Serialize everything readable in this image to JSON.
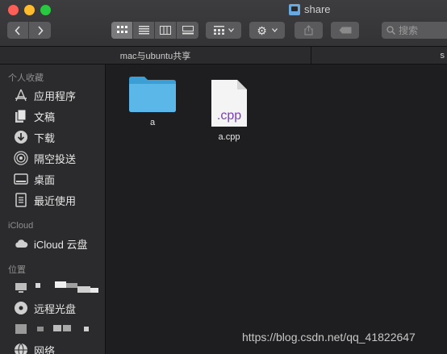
{
  "window": {
    "title": "share"
  },
  "toolbar": {
    "search_placeholder": "搜索"
  },
  "tabs": [
    {
      "label": "mac与ubuntu共享"
    },
    {
      "label": "s"
    }
  ],
  "sidebar": {
    "favorites_header": "个人收藏",
    "favorites": [
      {
        "label": "应用程序",
        "icon": "applications-icon"
      },
      {
        "label": "文稿",
        "icon": "documents-icon"
      },
      {
        "label": "下载",
        "icon": "downloads-icon"
      },
      {
        "label": "隔空投送",
        "icon": "airdrop-icon"
      },
      {
        "label": "桌面",
        "icon": "desktop-icon"
      },
      {
        "label": "最近使用",
        "icon": "recents-icon"
      }
    ],
    "icloud_header": "iCloud",
    "icloud": [
      {
        "label": "iCloud 云盘",
        "icon": "cloud-icon"
      }
    ],
    "locations_header": "位置",
    "locations": [
      {
        "label": "远程光盘",
        "icon": "disc-icon"
      },
      {
        "label": "网络",
        "icon": "network-icon"
      }
    ]
  },
  "files": [
    {
      "name": "a",
      "kind": "folder"
    },
    {
      "name": "a.cpp",
      "kind": "document",
      "badge": ".cpp"
    }
  ],
  "watermark": "https://blog.csdn.net/qq_41822647"
}
